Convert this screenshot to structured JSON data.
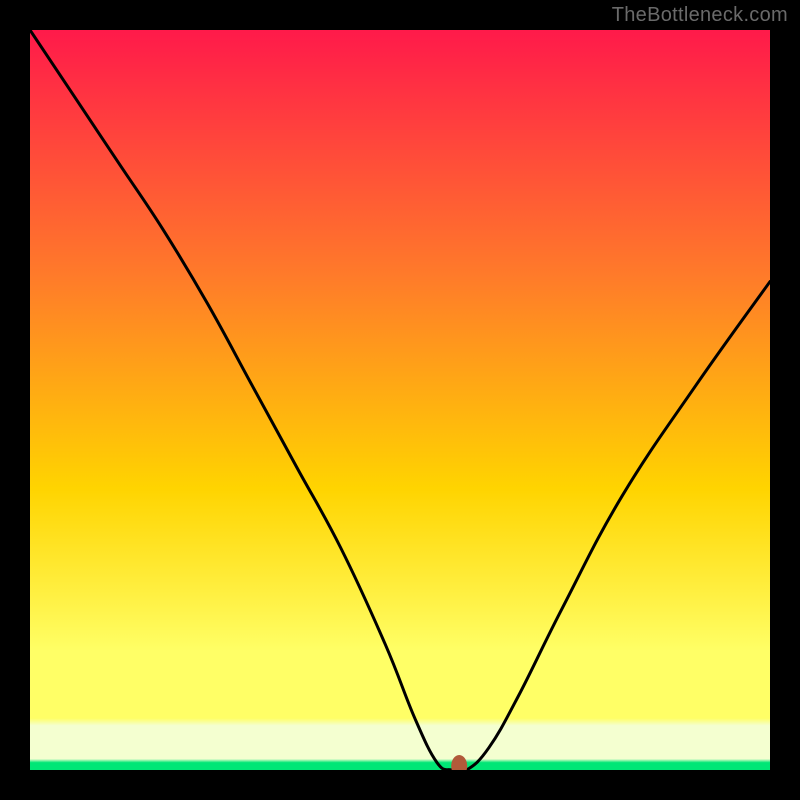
{
  "watermark": "TheBottleneck.com",
  "chart_data": {
    "type": "line",
    "title": "",
    "xlabel": "",
    "ylabel": "",
    "xlim": [
      0,
      100
    ],
    "ylim": [
      0,
      100
    ],
    "grid": false,
    "legend": false,
    "background_gradient": {
      "top": "#ff1a4a",
      "mid1": "#ff7a2a",
      "mid2": "#ffd400",
      "mid3": "#ffff66",
      "bottom_band": "#f4ffd0",
      "bottom_line": "#00e676"
    },
    "series": [
      {
        "name": "bottleneck-curve",
        "x": [
          0,
          6,
          12,
          18,
          24,
          30,
          36,
          42,
          48,
          52,
          55,
          57,
          59,
          62,
          66,
          72,
          80,
          90,
          100
        ],
        "y": [
          100,
          91,
          82,
          73,
          63,
          52,
          41,
          30,
          17,
          7,
          1,
          0,
          0,
          3,
          10,
          22,
          37,
          52,
          66
        ]
      }
    ],
    "marker": {
      "x": 58,
      "y": 0,
      "color": "#b15a3a"
    }
  },
  "colors": {
    "frame": "#000000",
    "curve": "#000000",
    "watermark": "#6a6a6a"
  }
}
